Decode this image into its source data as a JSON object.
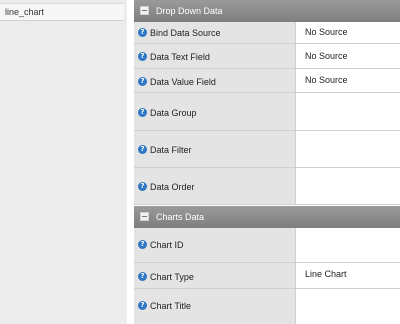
{
  "left_panel": {
    "items": [
      {
        "label": "line_chart"
      }
    ]
  },
  "sections": [
    {
      "title": "Drop Down Data",
      "rows": [
        {
          "label": "Bind Data Source",
          "value": "No Source"
        },
        {
          "label": "Data Text Field",
          "value": "No Source"
        },
        {
          "label": "Data Value Field",
          "value": "No Source"
        },
        {
          "label": "Data Group",
          "value": ""
        },
        {
          "label": "Data Filter",
          "value": ""
        },
        {
          "label": "Data Order",
          "value": ""
        }
      ]
    },
    {
      "title": "Charts Data",
      "rows": [
        {
          "label": "Chart ID",
          "value": ""
        },
        {
          "label": "Chart Type",
          "value": "Line Chart"
        },
        {
          "label": "Chart Title",
          "value": ""
        }
      ]
    }
  ],
  "colors": {
    "section_header": "#8a8a8a",
    "label_background": "#e4e4e4",
    "help_icon": "#2f77c4",
    "left_panel": "#ececec"
  }
}
